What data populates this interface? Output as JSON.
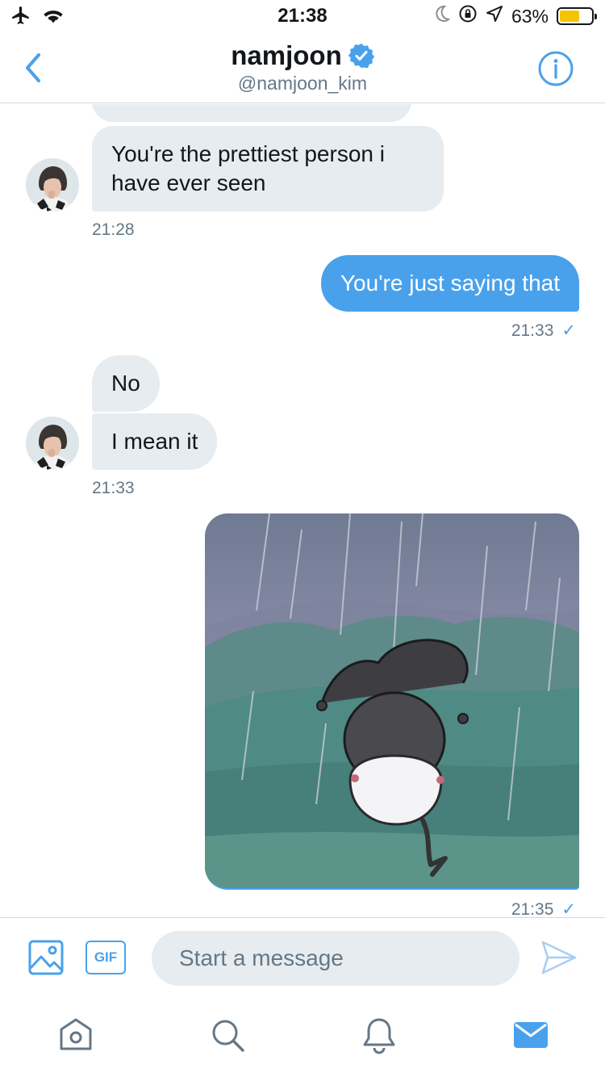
{
  "status_bar": {
    "time": "21:38",
    "battery": "63%",
    "battery_level": 0.63,
    "icons": [
      "airplane-icon",
      "wifi-icon",
      "moon-icon",
      "rotation-lock-icon",
      "location-icon",
      "battery-icon"
    ]
  },
  "header": {
    "title": "namjoon",
    "handle": "@namjoon_kim",
    "verified": true,
    "accent": "#4aa1eb"
  },
  "messages": {
    "m1": {
      "text": "You're the prettiest person i have ever seen",
      "time": "21:28",
      "direction": "incoming"
    },
    "m2": {
      "text": "You're just saying that",
      "time": "21:33",
      "check": "✓",
      "direction": "outgoing"
    },
    "m3": {
      "text": "No",
      "direction": "incoming"
    },
    "m4": {
      "text": "I mean it",
      "time": "21:33",
      "direction": "incoming"
    },
    "m5": {
      "type": "image",
      "time": "21:35",
      "check": "✓",
      "direction": "outgoing"
    }
  },
  "composer": {
    "placeholder": "Start a message",
    "gif_label": "GIF"
  },
  "tabs": [
    "home-icon",
    "search-icon",
    "notifications-icon",
    "messages-icon"
  ],
  "colors": {
    "accent": "#4aa1eb",
    "incoming_bubble": "#e6ecf0",
    "muted_text": "#657786"
  }
}
